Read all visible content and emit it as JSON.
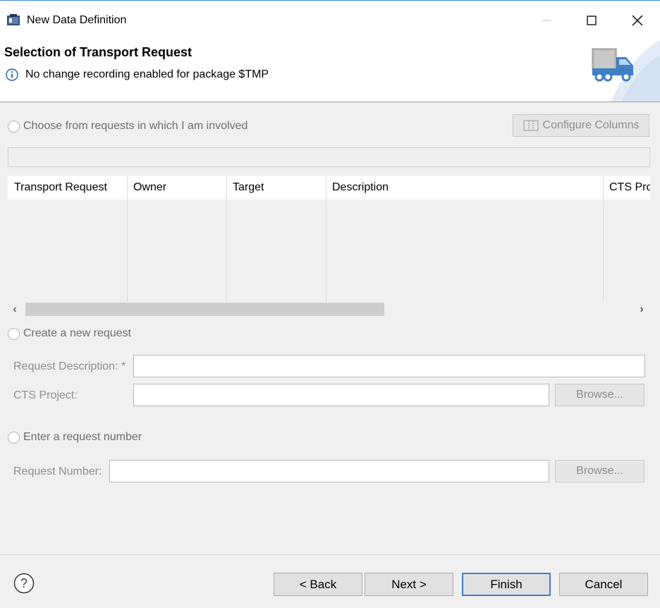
{
  "window": {
    "title": "New Data Definition",
    "controls": {
      "minimize": "minimize-icon",
      "maximize": "maximize-icon",
      "close": "close-icon"
    }
  },
  "header": {
    "title": "Selection of Transport Request",
    "message": "No change recording enabled for package $TMP",
    "message_icon": "info-icon",
    "graphic_icon": "truck-icon"
  },
  "involved": {
    "radio_label": "Choose from requests in which I am involved",
    "configure_columns_label": "Configure Columns",
    "filter_value": "",
    "table": {
      "columns": [
        "Transport Request",
        "Owner",
        "Target",
        "Description",
        "CTS Pro"
      ],
      "rows": []
    }
  },
  "new_request": {
    "radio_label": "Create a new request",
    "description_label": "Request Description: *",
    "description_value": "",
    "cts_project_label": "CTS Project:",
    "cts_project_value": "",
    "browse_label": "Browse..."
  },
  "request_number": {
    "radio_label": "Enter a request number",
    "number_label": "Request Number:",
    "number_value": "",
    "browse_label": "Browse..."
  },
  "footer": {
    "help_icon": "help-icon",
    "back_label": "< Back",
    "next_label": "Next >",
    "finish_label": "Finish",
    "cancel_label": "Cancel"
  },
  "colors": {
    "accent": "#3c7fd0",
    "window_border": "#3c8ad8",
    "disabled_text": "#8e8e8e"
  }
}
